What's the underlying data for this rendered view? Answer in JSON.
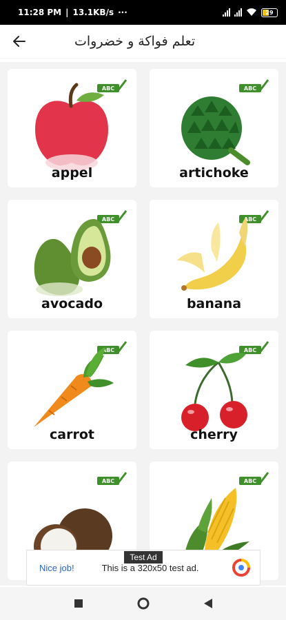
{
  "status_bar": {
    "time": "11:28 PM",
    "speed": "13.1KB/s",
    "dots": "···",
    "battery": "29"
  },
  "app_bar": {
    "title": "تعلم فواكة و خضروات",
    "back_icon": "arrow-left-icon"
  },
  "cards": [
    {
      "label": "appel",
      "icon": "apple-icon"
    },
    {
      "label": "artichoke",
      "icon": "artichoke-icon"
    },
    {
      "label": "avocado",
      "icon": "avocado-icon"
    },
    {
      "label": "banana",
      "icon": "banana-icon"
    },
    {
      "label": "carrot",
      "icon": "carrot-icon"
    },
    {
      "label": "cherry",
      "icon": "cherry-icon"
    },
    {
      "label": "",
      "icon": "coconut-icon"
    },
    {
      "label": "",
      "icon": "corn-icon"
    }
  ],
  "badge_text": "ABC",
  "ad": {
    "tag": "Test Ad",
    "left_text": "Nice job!",
    "body_text": "This is a 320x50 test ad."
  },
  "nav": {
    "recent_icon": "square-icon",
    "home_icon": "circle-icon",
    "back_icon": "triangle-back-icon"
  },
  "colors": {
    "apple_red": "#e2344a",
    "artichoke_green": "#2e7d32",
    "avocado_green": "#6b9a3a",
    "banana_yellow": "#f2cf4a",
    "carrot_orange": "#f08a1c",
    "cherry_red": "#d8202a",
    "corn_yellow": "#f5c027",
    "badge_green": "#3f8f2a",
    "ad_link": "#2a64c4"
  }
}
